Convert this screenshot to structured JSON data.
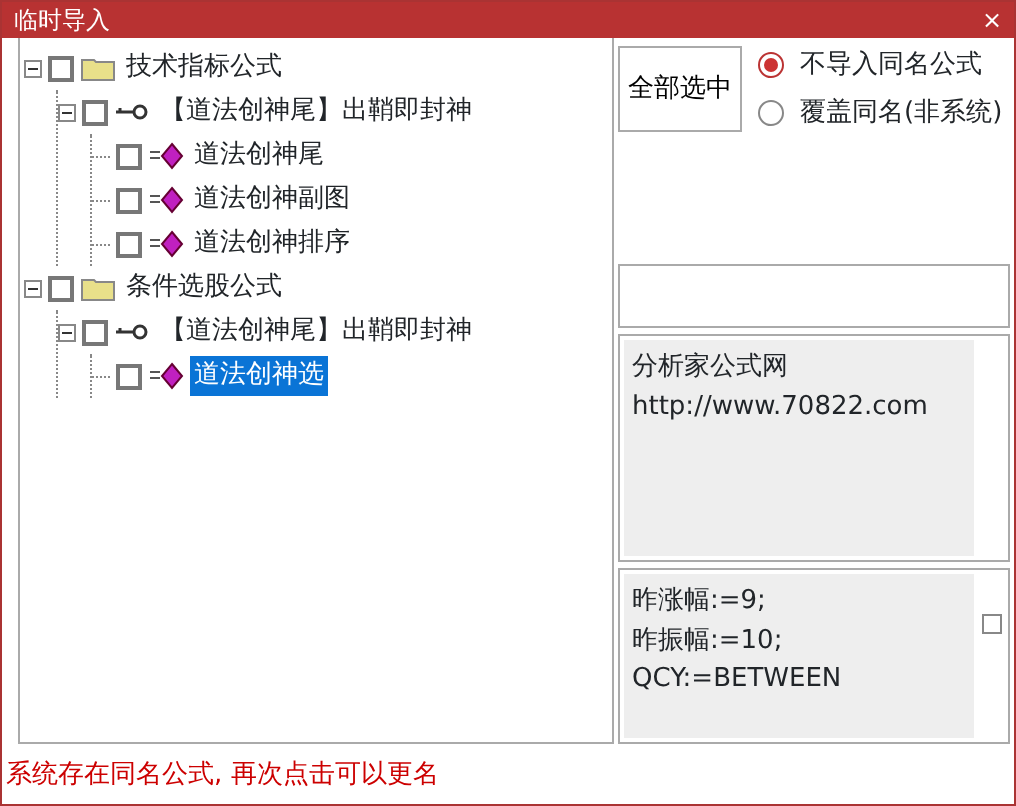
{
  "window": {
    "title": "临时导入",
    "close": "×"
  },
  "tree": [
    {
      "kind": "folder",
      "label": "技术指标公式",
      "expanded": true,
      "checked": false,
      "selected": false,
      "children": [
        {
          "kind": "group",
          "label": "【道法创神尾】出鞘即封神",
          "expanded": true,
          "checked": false,
          "selected": false,
          "children": [
            {
              "kind": "formula",
              "label": "道法创神尾",
              "checked": false,
              "selected": false
            },
            {
              "kind": "formula",
              "label": "道法创神副图",
              "checked": false,
              "selected": false
            },
            {
              "kind": "formula",
              "label": "道法创神排序",
              "checked": false,
              "selected": false
            }
          ]
        }
      ]
    },
    {
      "kind": "folder",
      "label": "条件选股公式",
      "expanded": true,
      "checked": false,
      "selected": false,
      "children": [
        {
          "kind": "group",
          "label": "【道法创神尾】出鞘即封神",
          "expanded": true,
          "checked": false,
          "selected": false,
          "children": [
            {
              "kind": "formula",
              "label": "道法创神选",
              "checked": false,
              "selected": true
            }
          ]
        }
      ]
    }
  ],
  "select_all_button": "全部选中",
  "options": [
    {
      "label": "不导入同名公式",
      "selected": true
    },
    {
      "label": "覆盖同名(非系统)",
      "selected": false
    }
  ],
  "info_lines": [
    "分析家公式网",
    "http://www.70822.com"
  ],
  "code_lines": [
    "昨涨幅:=9;",
    "昨振幅:=10;",
    "QCY:=BETWEEN"
  ],
  "code_checkbox": {
    "checked": false
  },
  "status_bar": "系统存在同名公式, 再次点击可以更名"
}
